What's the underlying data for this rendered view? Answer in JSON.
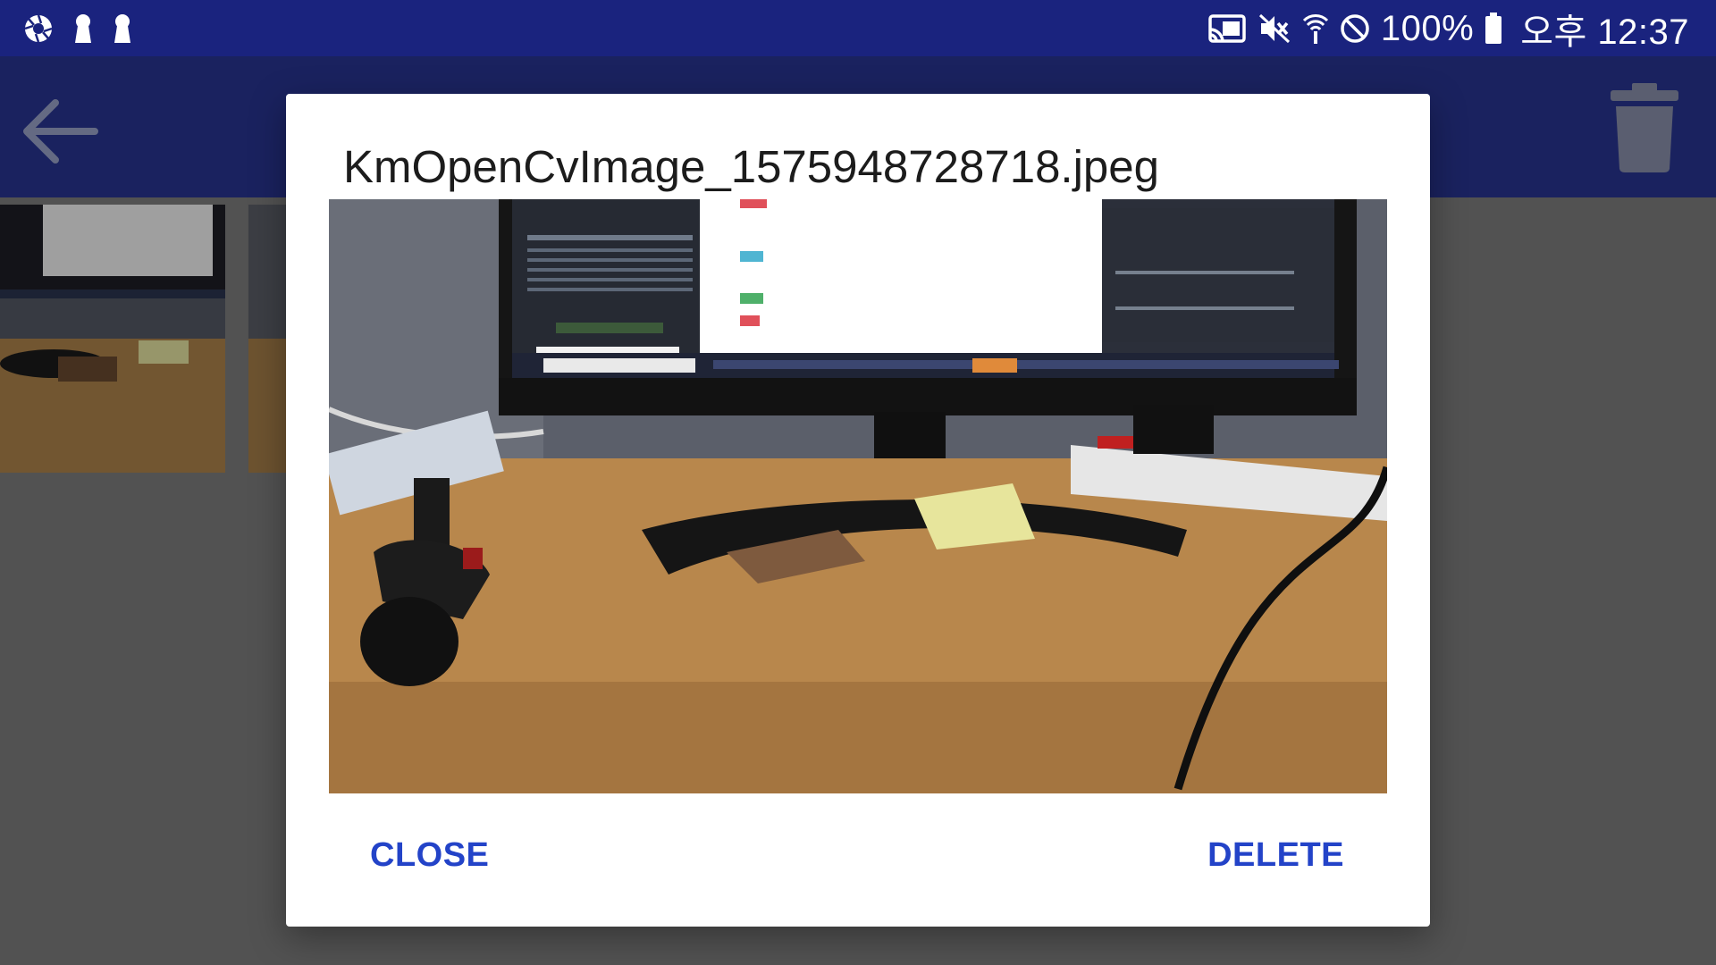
{
  "status_bar": {
    "left_icons": [
      "camera-aperture-icon",
      "keyhole-icon",
      "keyhole-icon"
    ],
    "right_icons": [
      "cast-icon",
      "mute-icon",
      "wifi-icon",
      "do-not-disturb-icon",
      "battery-icon"
    ],
    "battery": "100%",
    "time": "오후 12:37"
  },
  "app_bar": {
    "back_icon": "arrow-back-icon",
    "delete_icon": "trash-icon"
  },
  "dialog": {
    "title": "KmOpenCvImage_1575948728718.jpeg",
    "close_label": "CLOSE",
    "delete_label": "DELETE"
  },
  "colors": {
    "status_bar": "#1a237e",
    "app_bar": "#283593",
    "accent": "#2343c8"
  }
}
